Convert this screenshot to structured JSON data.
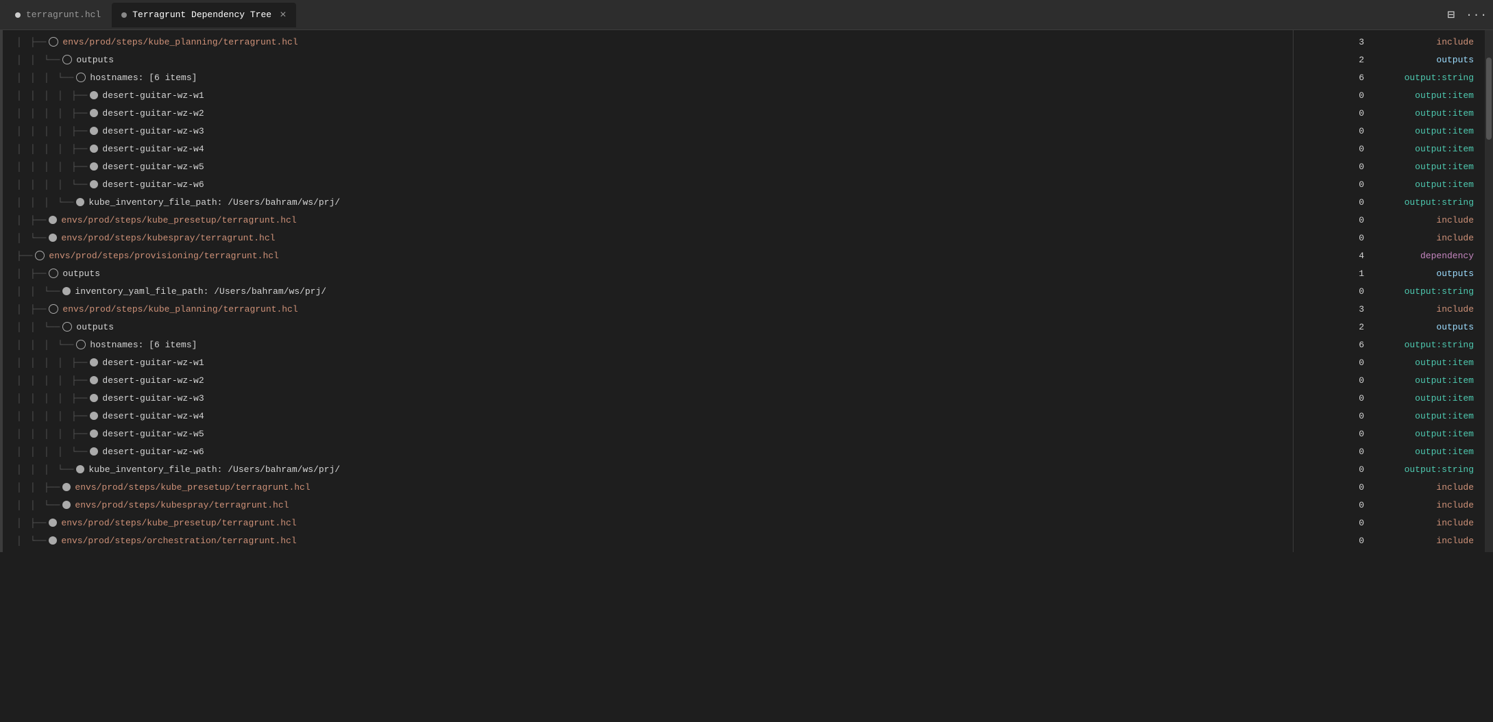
{
  "tabs": [
    {
      "id": "tab-hcl",
      "label": "terragrunt.hcl",
      "modified": true,
      "active": false
    },
    {
      "id": "tab-tree",
      "label": "Terragrunt Dependency Tree",
      "modified": false,
      "active": true,
      "closable": true
    }
  ],
  "toolbar_right": {
    "split_icon": "⊟",
    "more_icon": "···"
  },
  "tree": [
    {
      "indent": 1,
      "icon": "open",
      "lines": "├──",
      "label": "envs/prod/steps/kube_planning/terragrunt.hcl",
      "label_type": "path",
      "num": "3",
      "type": "include"
    },
    {
      "indent": 2,
      "icon": "open",
      "lines": "└──",
      "label": "outputs",
      "label_type": "normal",
      "num": "2",
      "type": "outputs"
    },
    {
      "indent": 3,
      "icon": "open",
      "lines": "└──",
      "label": "hostnames: [6 items]",
      "label_type": "normal",
      "num": "6",
      "type": "output:string"
    },
    {
      "indent": 4,
      "icon": "filled",
      "lines": "├──",
      "label": "desert-guitar-wz-w1",
      "label_type": "normal",
      "num": "0",
      "type": "output:item"
    },
    {
      "indent": 4,
      "icon": "filled",
      "lines": "├──",
      "label": "desert-guitar-wz-w2",
      "label_type": "normal",
      "num": "0",
      "type": "output:item"
    },
    {
      "indent": 4,
      "icon": "filled",
      "lines": "├──",
      "label": "desert-guitar-wz-w3",
      "label_type": "normal",
      "num": "0",
      "type": "output:item"
    },
    {
      "indent": 4,
      "icon": "filled",
      "lines": "├──",
      "label": "desert-guitar-wz-w4",
      "label_type": "normal",
      "num": "0",
      "type": "output:item"
    },
    {
      "indent": 4,
      "icon": "filled",
      "lines": "├──",
      "label": "desert-guitar-wz-w5",
      "label_type": "normal",
      "num": "0",
      "type": "output:item"
    },
    {
      "indent": 4,
      "icon": "filled",
      "lines": "└──",
      "label": "desert-guitar-wz-w6",
      "label_type": "normal",
      "num": "0",
      "type": "output:item"
    },
    {
      "indent": 3,
      "icon": "filled",
      "lines": "└──",
      "label": "kube_inventory_file_path: /Users/bahram/ws/prj/",
      "label_type": "normal",
      "num": "0",
      "type": "output:string"
    },
    {
      "indent": 1,
      "icon": "filled",
      "lines": "├──",
      "label": "envs/prod/steps/kube_presetup/terragrunt.hcl",
      "label_type": "path",
      "num": "0",
      "type": "include"
    },
    {
      "indent": 1,
      "icon": "filled",
      "lines": "└──",
      "label": "envs/prod/steps/kubespray/terragrunt.hcl",
      "label_type": "path",
      "num": "0",
      "type": "include"
    },
    {
      "indent": 0,
      "icon": "open",
      "lines": "├──",
      "label": "envs/prod/steps/provisioning/terragrunt.hcl",
      "label_type": "path",
      "num": "4",
      "type": "dependency"
    },
    {
      "indent": 1,
      "icon": "open",
      "lines": "├──",
      "label": "outputs",
      "label_type": "normal",
      "num": "1",
      "type": "outputs"
    },
    {
      "indent": 2,
      "icon": "filled",
      "lines": "└──",
      "label": "inventory_yaml_file_path: /Users/bahram/ws/prj/",
      "label_type": "normal",
      "num": "0",
      "type": "output:string"
    },
    {
      "indent": 1,
      "icon": "open",
      "lines": "├──",
      "label": "envs/prod/steps/kube_planning/terragrunt.hcl",
      "label_type": "path",
      "num": "3",
      "type": "include"
    },
    {
      "indent": 2,
      "icon": "open",
      "lines": "└──",
      "label": "outputs",
      "label_type": "normal",
      "num": "2",
      "type": "outputs"
    },
    {
      "indent": 3,
      "icon": "open",
      "lines": "└──",
      "label": "hostnames: [6 items]",
      "label_type": "normal",
      "num": "6",
      "type": "output:string"
    },
    {
      "indent": 4,
      "icon": "filled",
      "lines": "├──",
      "label": "desert-guitar-wz-w1",
      "label_type": "normal",
      "num": "0",
      "type": "output:item"
    },
    {
      "indent": 4,
      "icon": "filled",
      "lines": "├──",
      "label": "desert-guitar-wz-w2",
      "label_type": "normal",
      "num": "0",
      "type": "output:item"
    },
    {
      "indent": 4,
      "icon": "filled",
      "lines": "├──",
      "label": "desert-guitar-wz-w3",
      "label_type": "normal",
      "num": "0",
      "type": "output:item"
    },
    {
      "indent": 4,
      "icon": "filled",
      "lines": "├──",
      "label": "desert-guitar-wz-w4",
      "label_type": "normal",
      "num": "0",
      "type": "output:item"
    },
    {
      "indent": 4,
      "icon": "filled",
      "lines": "├──",
      "label": "desert-guitar-wz-w5",
      "label_type": "normal",
      "num": "0",
      "type": "output:item"
    },
    {
      "indent": 4,
      "icon": "filled",
      "lines": "└──",
      "label": "desert-guitar-wz-w6",
      "label_type": "normal",
      "num": "0",
      "type": "output:item"
    },
    {
      "indent": 3,
      "icon": "filled",
      "lines": "└──",
      "label": "kube_inventory_file_path: /Users/bahram/ws/prj/",
      "label_type": "normal",
      "num": "0",
      "type": "output:string"
    },
    {
      "indent": 2,
      "icon": "filled",
      "lines": "├──",
      "label": "envs/prod/steps/kube_presetup/terragrunt.hcl",
      "label_type": "path",
      "num": "0",
      "type": "include"
    },
    {
      "indent": 2,
      "icon": "filled",
      "lines": "└──",
      "label": "envs/prod/steps/kubespray/terragrunt.hcl",
      "label_type": "path",
      "num": "0",
      "type": "include"
    },
    {
      "indent": 1,
      "icon": "filled",
      "lines": "├──",
      "label": "envs/prod/steps/kube_presetup/terragrunt.hcl",
      "label_type": "path",
      "num": "0",
      "type": "include"
    },
    {
      "indent": 1,
      "icon": "filled",
      "lines": "└──",
      "label": "envs/prod/steps/orchestration/terragrunt.hcl",
      "label_type": "path",
      "num": "0",
      "type": "include"
    }
  ],
  "type_colors": {
    "include": "#ce9178",
    "outputs": "#9cdcfe",
    "output:string": "#4ec9b0",
    "output:item": "#4ec9b0",
    "dependency": "#c586c0"
  }
}
